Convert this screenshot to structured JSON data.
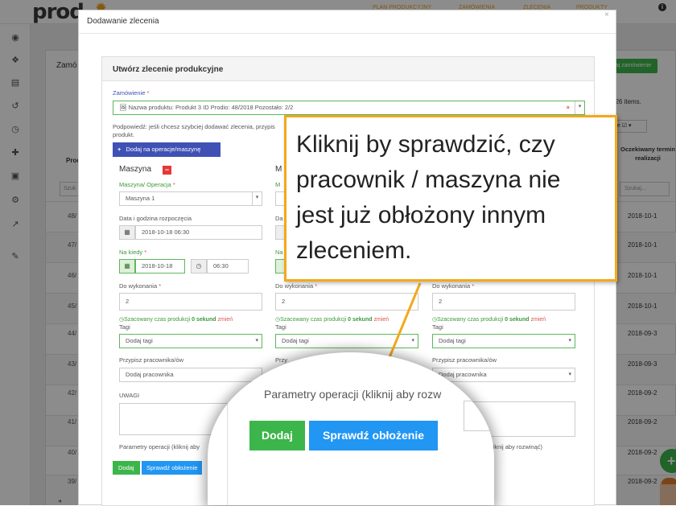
{
  "app": {
    "logo_text": "prod",
    "nav": [
      "PLAN PRODUKCYJNY",
      "ZAMÓWIENIA",
      "ZLECENIA",
      "PRODUKTY"
    ],
    "page_title_partial": "Zamó",
    "add_order_button": "aj zamówienie",
    "items_count": "f 26 items.",
    "view_dropdown": "ne",
    "col_header_left": "Produ",
    "col_header_right": "Oczekiwany termin realizacji",
    "search_placeholder": "Szukaj...",
    "search_left_placeholder": "Szuk",
    "rows": [
      {
        "id": "48/",
        "date": "2018-10-1"
      },
      {
        "id": "47/",
        "date": "2018-10-1"
      },
      {
        "id": "46/",
        "date": "2018-10-1"
      },
      {
        "id": "45/",
        "date": "2018-10-1"
      },
      {
        "id": "44/",
        "date": "2018-09-3"
      },
      {
        "id": "43/",
        "date": "2018-09-3"
      },
      {
        "id": "42/",
        "date": "2018-09-2"
      },
      {
        "id": "41/",
        "date": "2018-09-2"
      },
      {
        "id": "40/",
        "date": "2018-09-2"
      },
      {
        "id": "39/",
        "date": "2018-09-2"
      }
    ]
  },
  "modal": {
    "title": "Dodawanie zlecenia",
    "close": "×",
    "card_title": "Utwórz zlecenie produkcyjne",
    "order_label": "Zamówienie",
    "order_value": "Nazwa produktu: Produkt 3 ID Prodio: 48/2018 Pozostało: 2/2",
    "hint": "Podpowiedź: jeśli chcesz szybciej dodawać zlecenia, przypis",
    "hint2": "produkt.",
    "add_operation_button": "Dodaj na operacje/maszynę",
    "col1": {
      "header": "Maszyna",
      "machine_label": "Maszyna/ Operacja",
      "machine_value": "Maszyna 1",
      "start_label": "Data i godzina rozpoczęcia",
      "start_value": "2018-10-18 06:30",
      "deadline_label": "Na kiedy",
      "deadline_date": "2018-10-18",
      "deadline_time": "06:30",
      "todo_label": "Do wykonania",
      "todo_value": "2",
      "est_prefix": "Szacowany czas produkcji",
      "est_value": "0 sekund",
      "est_change": "zmień",
      "tags_label": "Tagi",
      "tags_placeholder": "Dodaj tagi",
      "workers_label": "Przypisz pracownika/ów",
      "workers_placeholder": "Dodaj pracownika",
      "notes_label": "UWAGI",
      "params_text": "Parametry operacji (kliknij aby",
      "add_button": "Dodaj",
      "check_button": "Sprawdź obłożenie"
    },
    "col2": {
      "header": "M",
      "machine_label_partial": "M",
      "start_label_partial": "Da",
      "deadline_label_partial": "Na",
      "todo_label": "Do wykonania",
      "todo_value": "2",
      "est_prefix": "Szacowany czas produkcji",
      "est_value": "0 sekund",
      "est_change": "zmień",
      "tags_label": "Tagi",
      "tags_placeholder": "Dodaj tagi",
      "workers_label_partial": "Przy"
    },
    "col3": {
      "todo_label": "Do wykonania",
      "todo_value": "2",
      "est_prefix": "Szacowany czas produkcji",
      "est_value": "0 sekund",
      "est_change": "zmień",
      "tags_label": "Tagi",
      "tags_placeholder": "Dodaj tagi",
      "workers_label": "Przypisz pracownika/ów",
      "workers_placeholder": "Dodaj pracownika",
      "params_text": "racji (kliknij aby rozwinąć)"
    }
  },
  "callout": {
    "text": "Kliknij by sprawdzić, czy\npracownik / maszyna nie\njest już obłożony innym\nzleceniem."
  },
  "magnifier": {
    "params_text": "Parametry operacji (kliknij aby rozw",
    "add_button": "Dodaj",
    "check_button": "Sprawdź obłożenie"
  },
  "colors": {
    "accent_orange": "#f2a91c",
    "green": "#3cb54a",
    "blue": "#2196f3",
    "indigo": "#3f51b5",
    "red": "#e53935"
  }
}
